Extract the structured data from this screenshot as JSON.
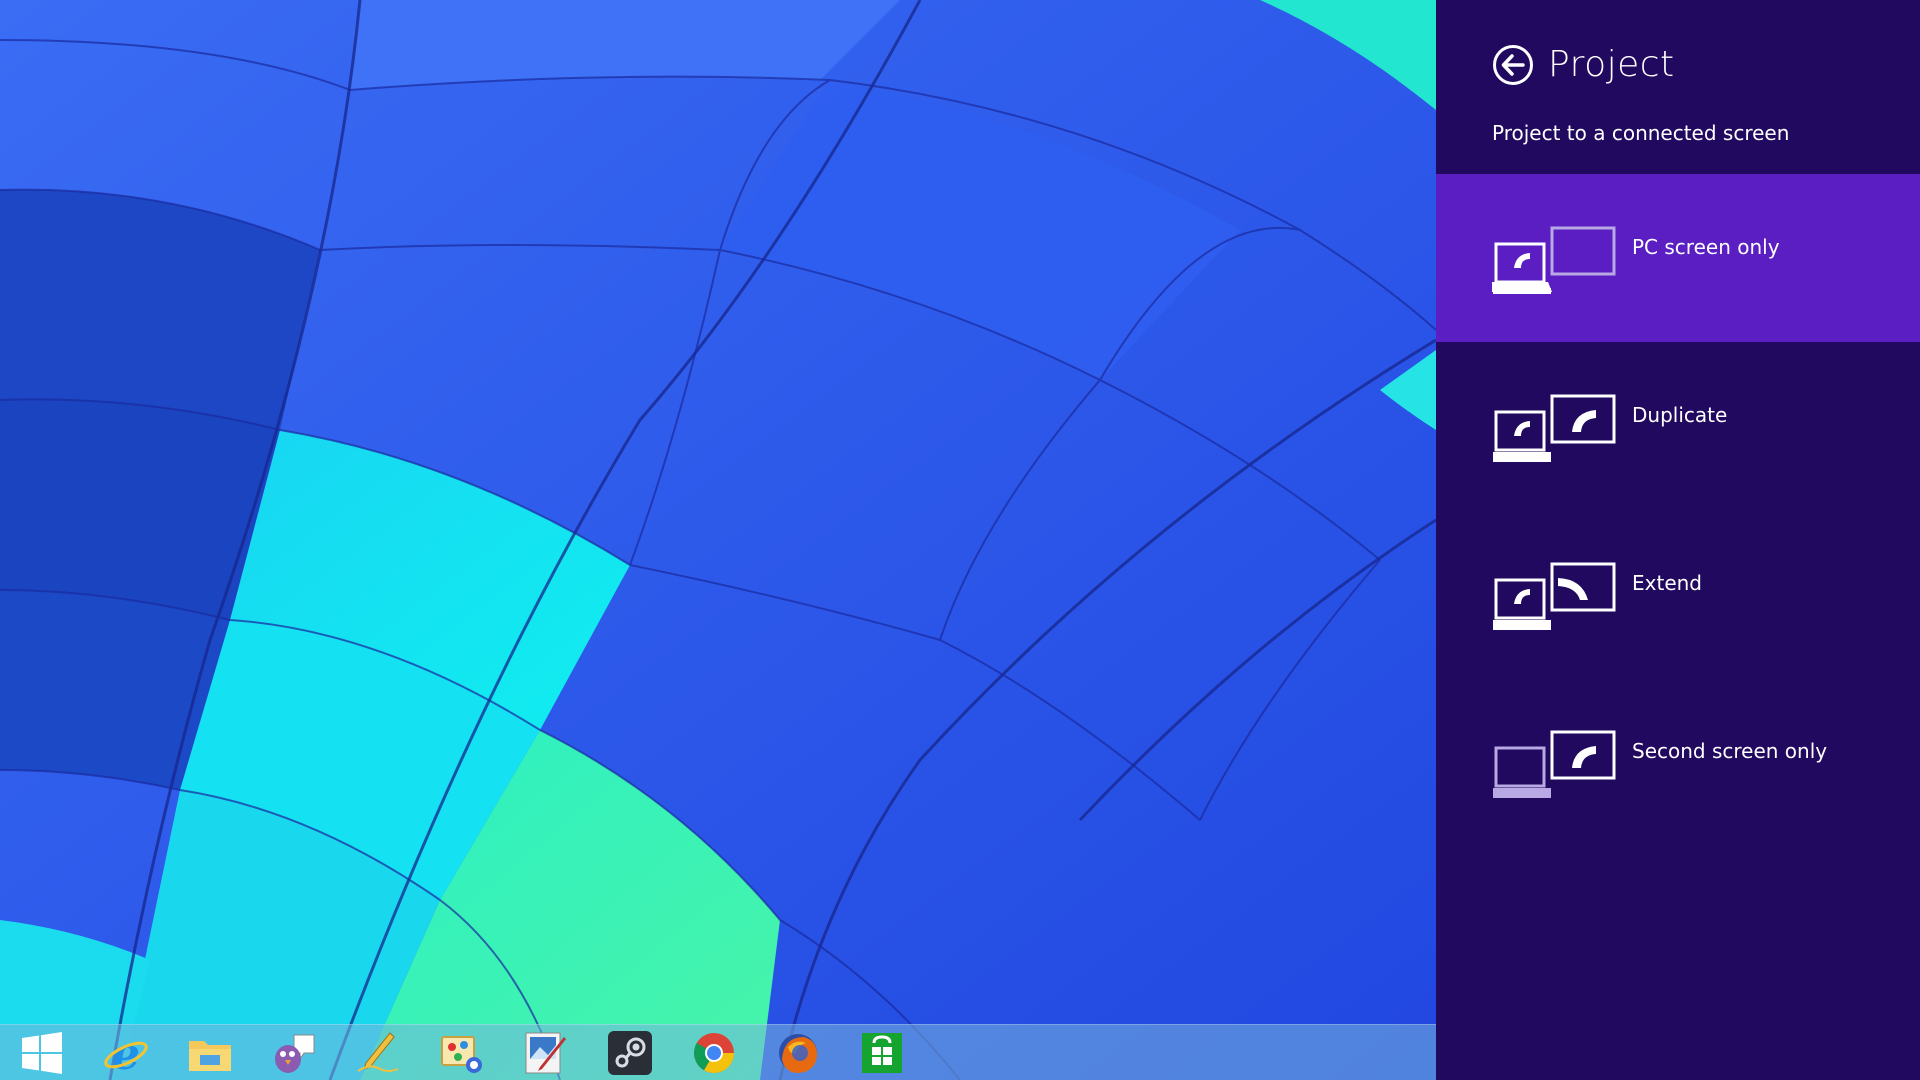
{
  "wallpaper": {
    "description_colors": {
      "blue": "#2f5ff0",
      "dark_blue": "#1b45c8",
      "cyan": "#12e6f0",
      "mint": "#33f2b6",
      "seam": "#1a2a9a"
    }
  },
  "taskbar": {
    "items": [
      {
        "name": "start-button",
        "icon": "windows-logo-icon"
      },
      {
        "name": "internet-explorer",
        "icon": "internet-explorer-icon"
      },
      {
        "name": "file-explorer",
        "icon": "folder-icon"
      },
      {
        "name": "pidgin",
        "icon": "pidgin-icon"
      },
      {
        "name": "inkscape",
        "icon": "inkscape-icon"
      },
      {
        "name": "paint-net",
        "icon": "paint-icon"
      },
      {
        "name": "image-editor",
        "icon": "image-editor-icon"
      },
      {
        "name": "steam",
        "icon": "steam-icon"
      },
      {
        "name": "chrome",
        "icon": "chrome-icon"
      },
      {
        "name": "firefox",
        "icon": "firefox-icon"
      },
      {
        "name": "store",
        "icon": "windows-store-icon"
      }
    ]
  },
  "pane": {
    "title": "Project",
    "subtitle": "Project to a connected screen",
    "background": "#21095f",
    "selected_background": "#5a1ec3",
    "options": [
      {
        "label": "PC screen only",
        "icon": "pc-screen-only-icon",
        "selected": true
      },
      {
        "label": "Duplicate",
        "icon": "duplicate-icon",
        "selected": false
      },
      {
        "label": "Extend",
        "icon": "extend-icon",
        "selected": false
      },
      {
        "label": "Second screen only",
        "icon": "second-screen-only-icon",
        "selected": false
      }
    ]
  }
}
